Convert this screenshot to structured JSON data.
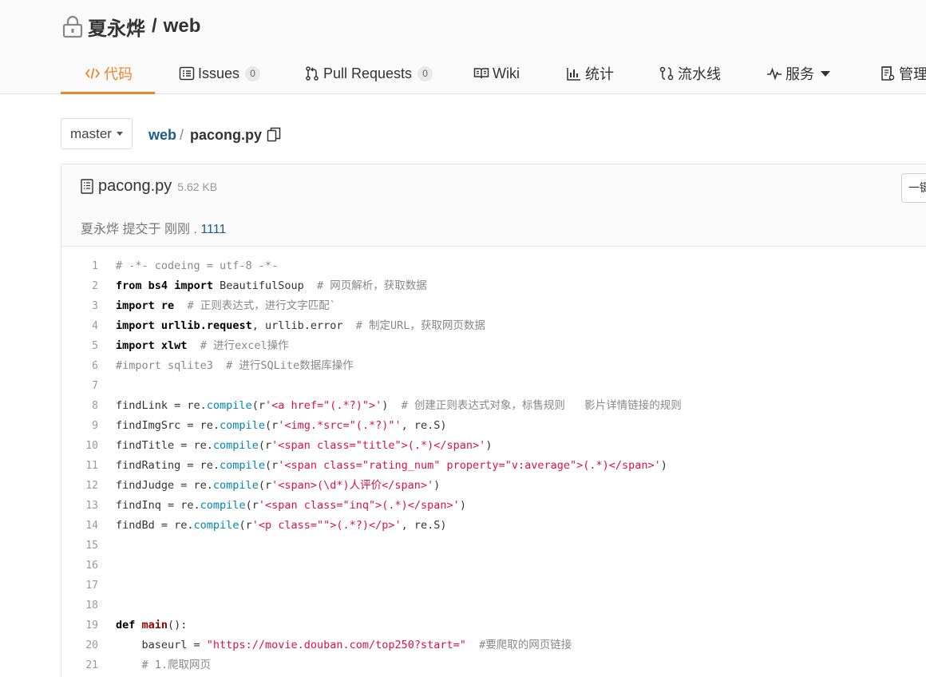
{
  "repo": {
    "owner": "夏永烨",
    "separator": "/",
    "name": "web"
  },
  "tabs": [
    {
      "label": "代码",
      "icon": "code-icon",
      "active": true
    },
    {
      "label": "Issues",
      "count": "0",
      "icon": "issues-icon"
    },
    {
      "label": "Pull Requests",
      "count": "0",
      "icon": "pull-request-icon"
    },
    {
      "label": "Wiki",
      "icon": "wiki-icon"
    },
    {
      "label": "统计",
      "icon": "stats-icon"
    },
    {
      "label": "流水线",
      "icon": "pipeline-icon"
    },
    {
      "label": "服务",
      "icon": "service-icon"
    },
    {
      "label": "管理",
      "icon": "manage-icon"
    }
  ],
  "branch": {
    "label": "master"
  },
  "breadcrumb": {
    "root": "web",
    "slash": "/",
    "file": "pacong.py"
  },
  "file": {
    "name": "pacong.py",
    "size": "5.62 KB",
    "action_label": "一键复制",
    "commit_author": "夏永烨",
    "commit_text": "提交于",
    "commit_time": "刚刚",
    "commit_dot": ".",
    "commit_message": "1111"
  },
  "colors": {
    "accent": "#f0842c",
    "link": "#1a5d8c",
    "keyword": "#000000",
    "string": "#dd1144",
    "function": "#0086b3",
    "comment": "#888888"
  },
  "code_lines": [
    {
      "n": "1",
      "tokens": [
        {
          "t": "cm",
          "v": "# -*- codeing = utf-8 -*-"
        }
      ]
    },
    {
      "n": "2",
      "tokens": [
        {
          "t": "kw",
          "v": "from"
        },
        {
          "t": "tx",
          "v": " "
        },
        {
          "t": "kw",
          "v": "bs4"
        },
        {
          "t": "tx",
          "v": " "
        },
        {
          "t": "kw",
          "v": "import"
        },
        {
          "t": "tx",
          "v": " BeautifulSoup  "
        },
        {
          "t": "cm",
          "v": "# 网页解析，获取数据"
        }
      ]
    },
    {
      "n": "3",
      "tokens": [
        {
          "t": "kw",
          "v": "import"
        },
        {
          "t": "tx",
          "v": " "
        },
        {
          "t": "kw",
          "v": "re"
        },
        {
          "t": "tx",
          "v": "  "
        },
        {
          "t": "cm",
          "v": "# 正则表达式，进行文字匹配`"
        }
      ]
    },
    {
      "n": "4",
      "tokens": [
        {
          "t": "kw",
          "v": "import"
        },
        {
          "t": "tx",
          "v": " "
        },
        {
          "t": "kw",
          "v": "urllib.request"
        },
        {
          "t": "tx",
          "v": ", urllib.error  "
        },
        {
          "t": "cm",
          "v": "# 制定URL，获取网页数据"
        }
      ]
    },
    {
      "n": "5",
      "tokens": [
        {
          "t": "kw",
          "v": "import"
        },
        {
          "t": "tx",
          "v": " "
        },
        {
          "t": "kw",
          "v": "xlwt"
        },
        {
          "t": "tx",
          "v": "  "
        },
        {
          "t": "cm",
          "v": "# 进行excel操作"
        }
      ]
    },
    {
      "n": "6",
      "tokens": [
        {
          "t": "cm",
          "v": "#import sqlite3  # 进行SQLite数据库操作"
        }
      ]
    },
    {
      "n": "7",
      "tokens": []
    },
    {
      "n": "8",
      "tokens": [
        {
          "t": "tx",
          "v": "findLink = re."
        },
        {
          "t": "fn",
          "v": "compile"
        },
        {
          "t": "tx",
          "v": "(r"
        },
        {
          "t": "st",
          "v": "'<a href=\"(.*?)\">'"
        },
        {
          "t": "tx",
          "v": ")  "
        },
        {
          "t": "cm",
          "v": "# 创建正则表达式对象，标售规则   影片详情链接的规则"
        }
      ]
    },
    {
      "n": "9",
      "tokens": [
        {
          "t": "tx",
          "v": "findImgSrc = re."
        },
        {
          "t": "fn",
          "v": "compile"
        },
        {
          "t": "tx",
          "v": "(r"
        },
        {
          "t": "st",
          "v": "'<img.*src=\"(.*?)\"'"
        },
        {
          "t": "tx",
          "v": ", re.S)"
        }
      ]
    },
    {
      "n": "10",
      "tokens": [
        {
          "t": "tx",
          "v": "findTitle = re."
        },
        {
          "t": "fn",
          "v": "compile"
        },
        {
          "t": "tx",
          "v": "(r"
        },
        {
          "t": "st",
          "v": "'<span class=\"title\">(.*)</span>'"
        },
        {
          "t": "tx",
          "v": ")"
        }
      ]
    },
    {
      "n": "11",
      "tokens": [
        {
          "t": "tx",
          "v": "findRating = re."
        },
        {
          "t": "fn",
          "v": "compile"
        },
        {
          "t": "tx",
          "v": "(r"
        },
        {
          "t": "st",
          "v": "'<span class=\"rating_num\" property=\"v:average\">(.*)</span>'"
        },
        {
          "t": "tx",
          "v": ")"
        }
      ]
    },
    {
      "n": "12",
      "tokens": [
        {
          "t": "tx",
          "v": "findJudge = re."
        },
        {
          "t": "fn",
          "v": "compile"
        },
        {
          "t": "tx",
          "v": "(r"
        },
        {
          "t": "st",
          "v": "'<span>(\\d*)人评价</span>'"
        },
        {
          "t": "tx",
          "v": ")"
        }
      ]
    },
    {
      "n": "13",
      "tokens": [
        {
          "t": "tx",
          "v": "findInq = re."
        },
        {
          "t": "fn",
          "v": "compile"
        },
        {
          "t": "tx",
          "v": "(r"
        },
        {
          "t": "st",
          "v": "'<span class=\"inq\">(.*)</span>'"
        },
        {
          "t": "tx",
          "v": ")"
        }
      ]
    },
    {
      "n": "14",
      "tokens": [
        {
          "t": "tx",
          "v": "findBd = re."
        },
        {
          "t": "fn",
          "v": "compile"
        },
        {
          "t": "tx",
          "v": "(r"
        },
        {
          "t": "st",
          "v": "'<p class=\"\">(.*?)</p>'"
        },
        {
          "t": "tx",
          "v": ", re.S)"
        }
      ]
    },
    {
      "n": "15",
      "tokens": []
    },
    {
      "n": "16",
      "tokens": []
    },
    {
      "n": "17",
      "tokens": []
    },
    {
      "n": "18",
      "tokens": []
    },
    {
      "n": "19",
      "tokens": [
        {
          "t": "kw",
          "v": "def"
        },
        {
          "t": "tx",
          "v": " "
        },
        {
          "t": "df",
          "v": "main"
        },
        {
          "t": "tx",
          "v": "():"
        }
      ]
    },
    {
      "n": "20",
      "tokens": [
        {
          "t": "tx",
          "v": "    baseurl = "
        },
        {
          "t": "st",
          "v": "\"https://movie.douban.com/top250?start=\""
        },
        {
          "t": "tx",
          "v": "  "
        },
        {
          "t": "cm",
          "v": "#要爬取的网页链接"
        }
      ]
    },
    {
      "n": "21",
      "tokens": [
        {
          "t": "tx",
          "v": "    "
        },
        {
          "t": "cm",
          "v": "# 1.爬取网页"
        }
      ]
    }
  ]
}
